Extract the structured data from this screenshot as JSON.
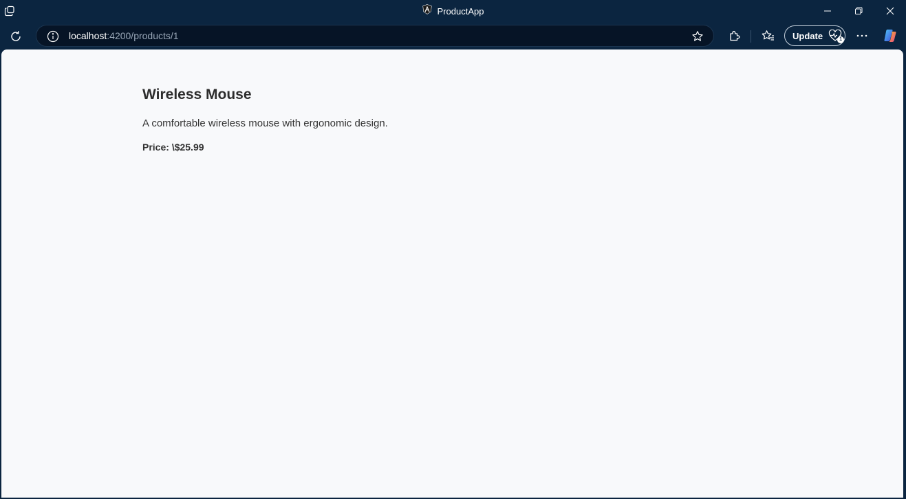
{
  "window": {
    "title": "ProductApp",
    "icon": "angular-logo-icon"
  },
  "toolbar": {
    "url_host": "localhost",
    "url_rest": ":4200/products/1",
    "update_label": "Update",
    "update_badge": "1"
  },
  "product": {
    "name": "Wireless Mouse",
    "description": "A comfortable wireless mouse with ergonomic design.",
    "price_label": "Price:",
    "price_value": "\\$25.99"
  },
  "colors": {
    "chrome": "#0b2540",
    "page_background": "#f8f9fb",
    "text": "#333333"
  }
}
